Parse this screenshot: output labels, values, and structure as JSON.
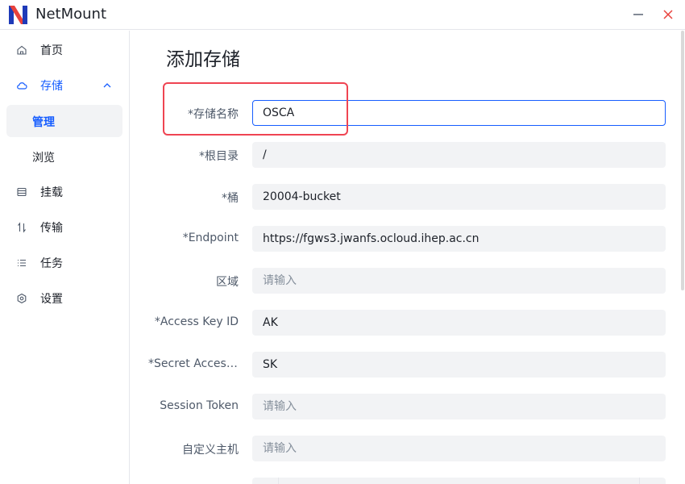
{
  "app": {
    "name": "NetMount",
    "brand_color": "#165dff",
    "logo_red": "#e8413c",
    "logo_blue": "#1e3ab8"
  },
  "sidebar": {
    "items": [
      {
        "label": "首页",
        "icon": "home-icon"
      },
      {
        "label": "存储",
        "icon": "cloud-icon",
        "expanded": true
      },
      {
        "label": "挂载",
        "icon": "drive-icon"
      },
      {
        "label": "传输",
        "icon": "transfer-icon"
      },
      {
        "label": "任务",
        "icon": "list-icon"
      },
      {
        "label": "设置",
        "icon": "gear-icon"
      }
    ],
    "storage_sub": [
      {
        "label": "管理",
        "selected": true
      },
      {
        "label": "浏览",
        "selected": false
      }
    ]
  },
  "main": {
    "title": "添加存储",
    "fields": [
      {
        "label": "*存储名称",
        "value": "OSCA",
        "placeholder": ""
      },
      {
        "label": "*根目录",
        "value": "/",
        "placeholder": ""
      },
      {
        "label": "*桶",
        "value": "20004-bucket",
        "placeholder": ""
      },
      {
        "label": "*Endpoint",
        "value": "https://fgws3.jwanfs.ocloud.ihep.ac.cn",
        "placeholder": ""
      },
      {
        "label": "区域",
        "value": "",
        "placeholder": "请输入"
      },
      {
        "label": "*Access Key ID",
        "value": "AK",
        "placeholder": ""
      },
      {
        "label": "*Secret Access Key",
        "value": "SK",
        "placeholder": ""
      },
      {
        "label": "Session Token",
        "value": "",
        "placeholder": "请输入"
      },
      {
        "label": "自定义主机",
        "value": "",
        "placeholder": "请输入"
      }
    ]
  }
}
